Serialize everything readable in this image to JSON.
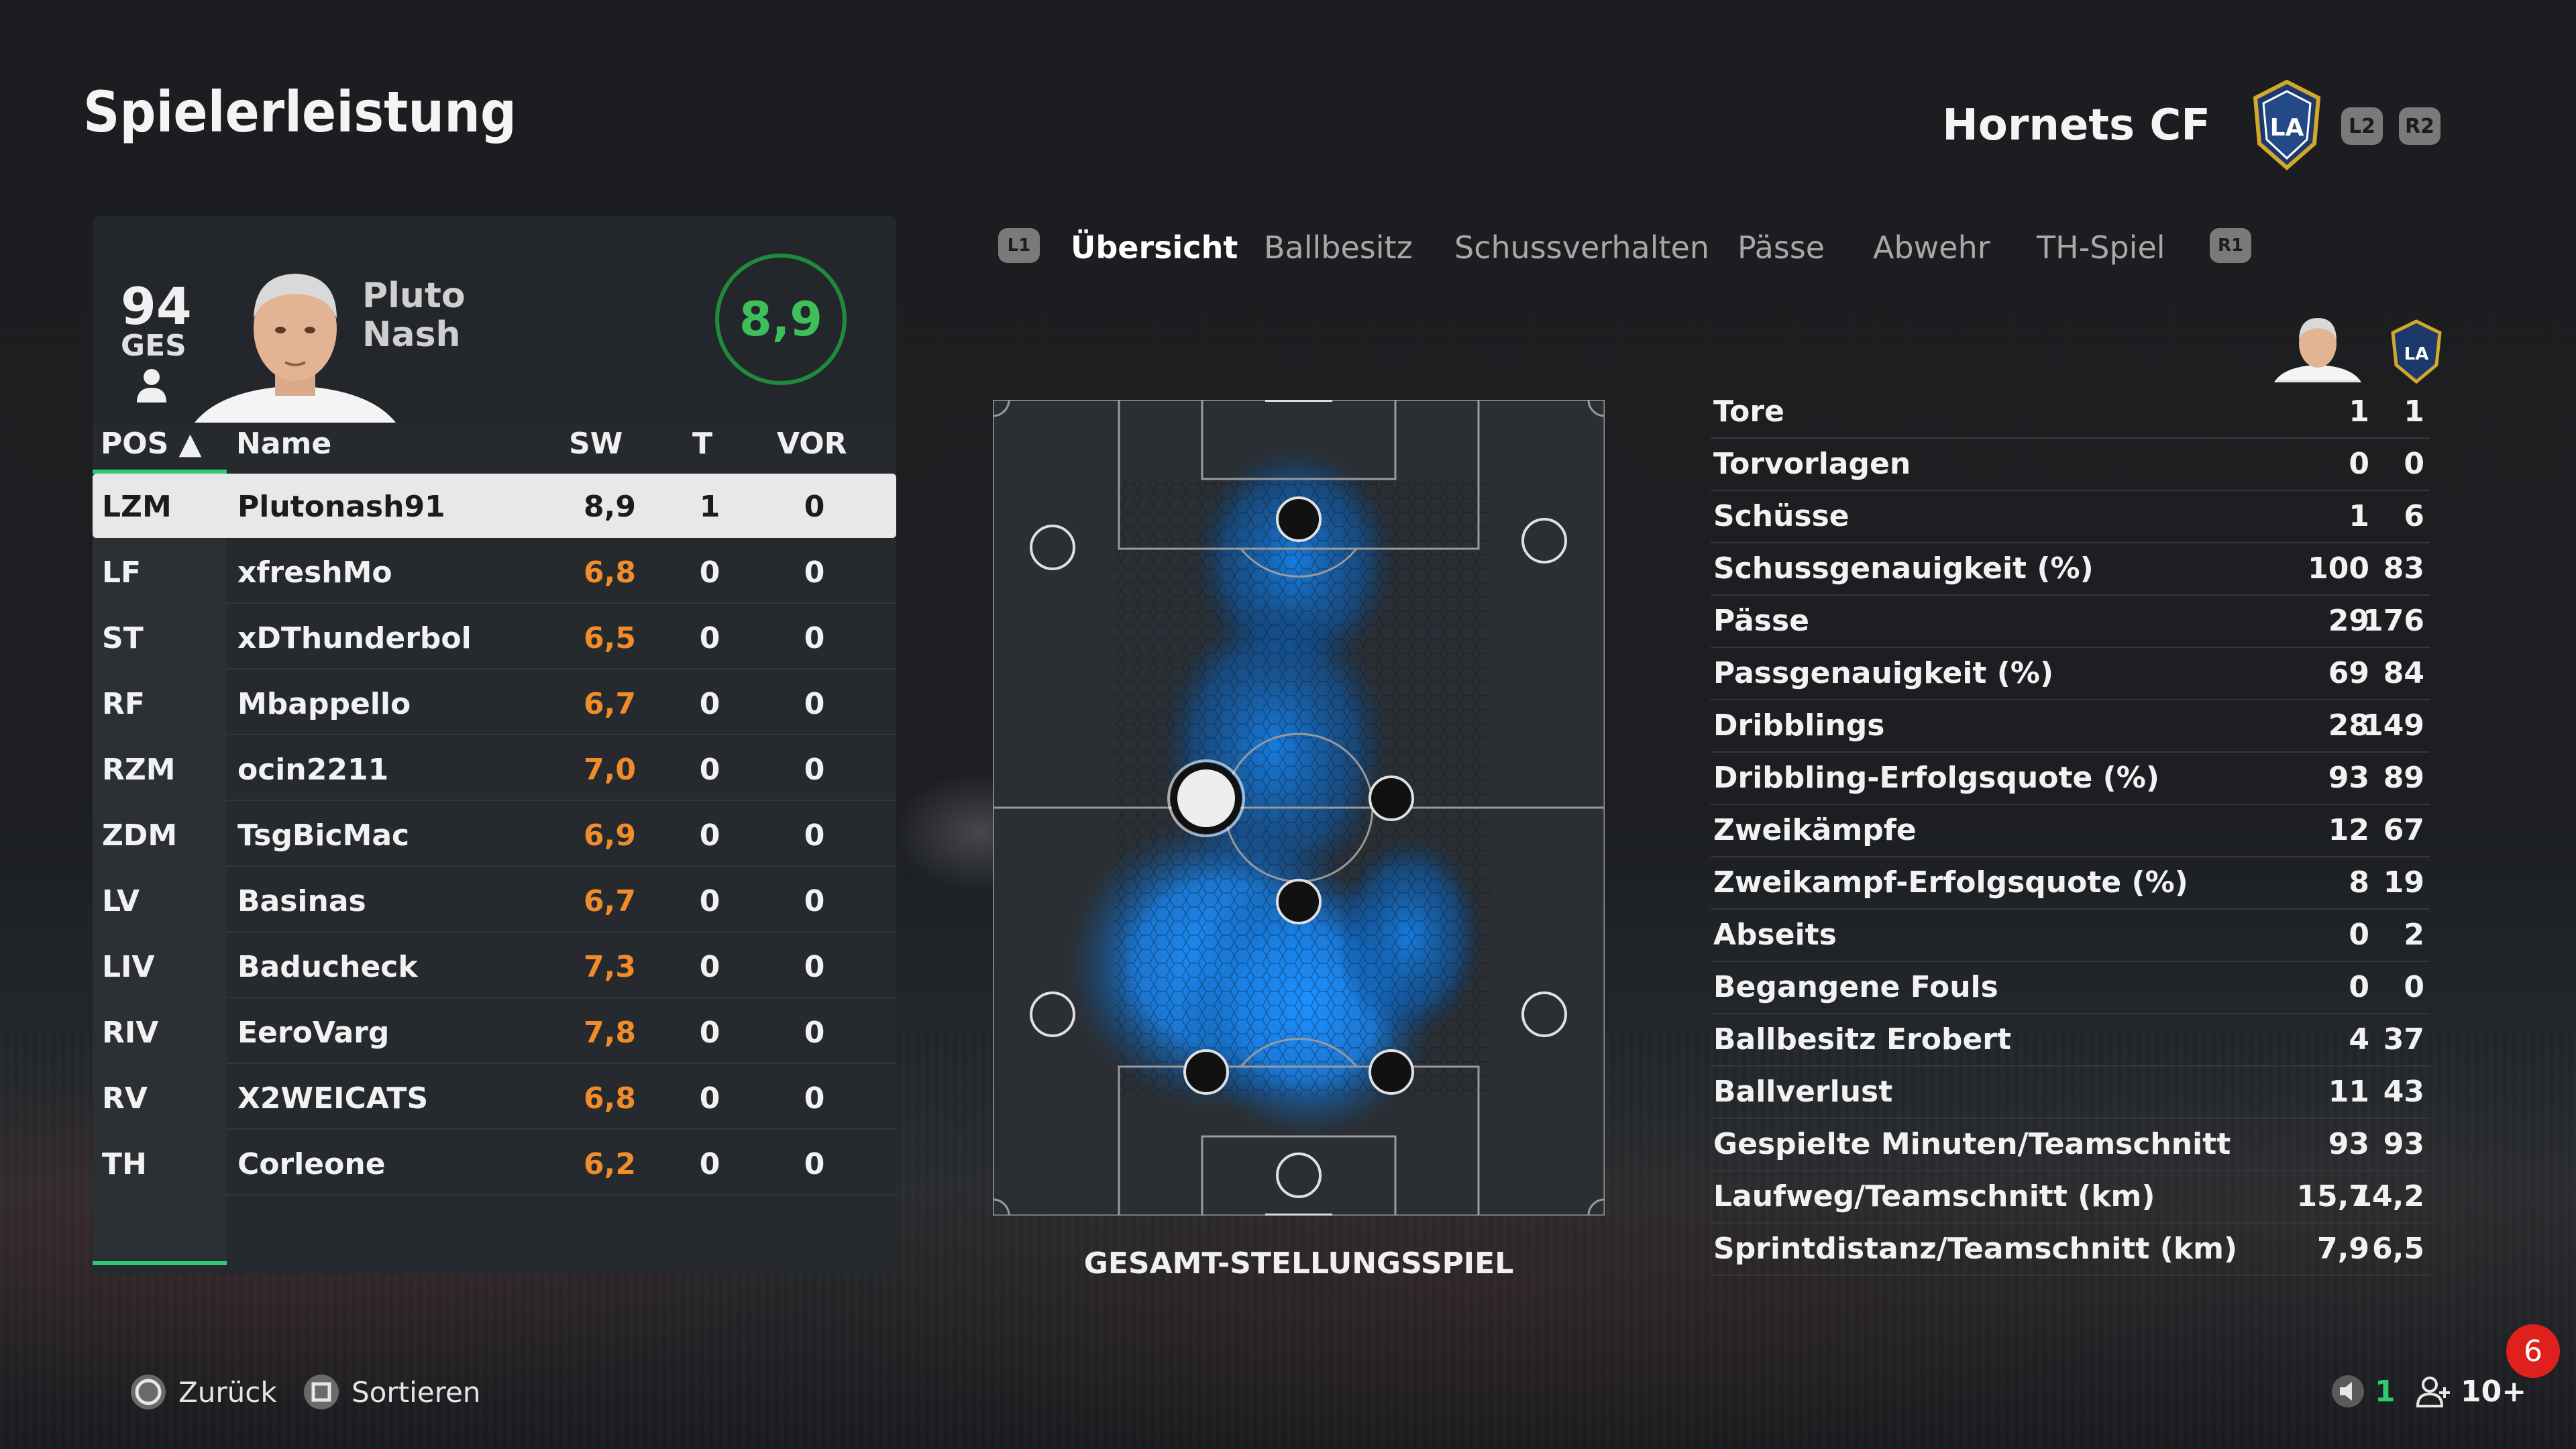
{
  "page": {
    "title": "Spielerleistung"
  },
  "team": {
    "name": "Hornets CF",
    "crest_text": "LA",
    "l2": "L2",
    "r2": "R2"
  },
  "player": {
    "overall": "94",
    "overall_label": "GES",
    "first_name": "Pluto",
    "last_name": "Nash",
    "rating": "8,9"
  },
  "table": {
    "headers": {
      "pos": "POS ▲",
      "name": "Name",
      "sw": "SW",
      "t": "T",
      "vor": "VOR"
    },
    "rows": [
      {
        "pos": "LZM",
        "name": "Plutonash91",
        "sw": "8,9",
        "t": "1",
        "vor": "0",
        "selected": true
      },
      {
        "pos": "LF",
        "name": "xfreshMo",
        "sw": "6,8",
        "t": "0",
        "vor": "0"
      },
      {
        "pos": "ST",
        "name": "xDThunderbol",
        "sw": "6,5",
        "t": "0",
        "vor": "0"
      },
      {
        "pos": "RF",
        "name": "Mbappello",
        "sw": "6,7",
        "t": "0",
        "vor": "0"
      },
      {
        "pos": "RZM",
        "name": "ocin2211",
        "sw": "7,0",
        "t": "0",
        "vor": "0"
      },
      {
        "pos": "ZDM",
        "name": "TsgBicMac",
        "sw": "6,9",
        "t": "0",
        "vor": "0"
      },
      {
        "pos": "LV",
        "name": "Basinas",
        "sw": "6,7",
        "t": "0",
        "vor": "0"
      },
      {
        "pos": "LIV",
        "name": "Baducheck",
        "sw": "7,3",
        "t": "0",
        "vor": "0"
      },
      {
        "pos": "RIV",
        "name": "EeroVarg",
        "sw": "7,8",
        "t": "0",
        "vor": "0"
      },
      {
        "pos": "RV",
        "name": "X2WEICATS",
        "sw": "6,8",
        "t": "0",
        "vor": "0"
      },
      {
        "pos": "TH",
        "name": "Corleone",
        "sw": "6,2",
        "t": "0",
        "vor": "0"
      }
    ]
  },
  "tabs": {
    "l1": "L1",
    "r1": "R1",
    "items": [
      "Übersicht",
      "Ballbesitz",
      "Schussverhalten",
      "Pässe",
      "Abwehr",
      "TH-Spiel"
    ],
    "active": "Übersicht"
  },
  "heatmap": {
    "label": "GESAMT-STELLUNGSSPIEL",
    "accent": "#1e90ff"
  },
  "stats": [
    {
      "label": "Tore",
      "player": "1",
      "team": "1"
    },
    {
      "label": "Torvorlagen",
      "player": "0",
      "team": "0"
    },
    {
      "label": "Schüsse",
      "player": "1",
      "team": "6"
    },
    {
      "label": "Schussgenauigkeit (%)",
      "player": "100",
      "team": "83"
    },
    {
      "label": "Pässe",
      "player": "29",
      "team": "176"
    },
    {
      "label": "Passgenauigkeit (%)",
      "player": "69",
      "team": "84"
    },
    {
      "label": "Dribblings",
      "player": "28",
      "team": "149"
    },
    {
      "label": "Dribbling-Erfolgsquote (%)",
      "player": "93",
      "team": "89"
    },
    {
      "label": "Zweikämpfe",
      "player": "12",
      "team": "67"
    },
    {
      "label": "Zweikampf-Erfolgsquote (%)",
      "player": "8",
      "team": "19"
    },
    {
      "label": "Abseits",
      "player": "0",
      "team": "2"
    },
    {
      "label": "Begangene Fouls",
      "player": "0",
      "team": "0"
    },
    {
      "label": "Ballbesitz Erobert",
      "player": "4",
      "team": "37"
    },
    {
      "label": "Ballverlust",
      "player": "11",
      "team": "43"
    },
    {
      "label": "Gespielte Minuten/Teamschnitt",
      "player": "93",
      "team": "93"
    },
    {
      "label": "Laufweg/Teamschnitt (km)",
      "player": "15,7",
      "team": "14,2"
    },
    {
      "label": "Sprintdistanz/Teamschnitt (km)",
      "player": "7,9",
      "team": "6,5"
    }
  ],
  "footer": {
    "back": "Zurück",
    "sort": "Sortieren",
    "notification_count": "6",
    "voice_count": "1",
    "party_count": "10+"
  },
  "colors": {
    "rating_green": "#2ecc71",
    "sw_orange": "#f08c2a",
    "notification_red": "#e0201c"
  }
}
